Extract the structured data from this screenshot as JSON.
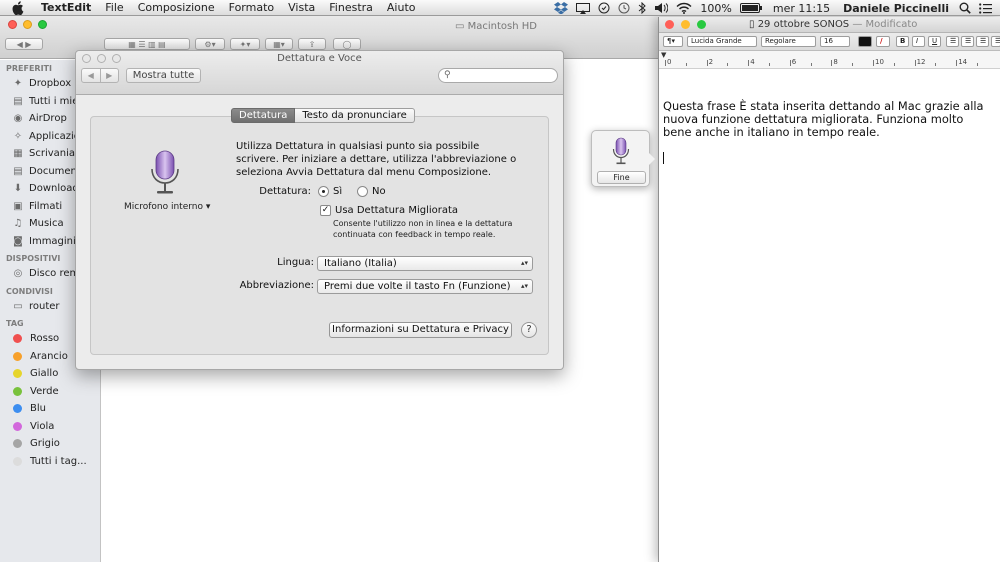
{
  "menubar": {
    "app": "TextEdit",
    "items": [
      "File",
      "Composizione",
      "Formato",
      "Vista",
      "Finestra",
      "Aiuto"
    ],
    "battery": "100%",
    "clock": "mer 11:15",
    "user": "Daniele Piccinelli"
  },
  "finder": {
    "title": "Macintosh HD",
    "sections": {
      "favorites": "PREFERITI",
      "devices": "DISPOSITIVI",
      "shared": "CONDIVISI",
      "tags": "TAG"
    },
    "favorites": [
      "Dropbox",
      "Tutti i miei",
      "AirDrop",
      "Applicazioni",
      "Scrivania",
      "Documenti",
      "Download",
      "Filmati",
      "Musica",
      "Immagini"
    ],
    "devices": [
      "Disco remoto"
    ],
    "shared": [
      "router"
    ],
    "tags": [
      {
        "label": "Rosso",
        "color": "#f0504f"
      },
      {
        "label": "Arancio",
        "color": "#f7a02b"
      },
      {
        "label": "Giallo",
        "color": "#e6d52c"
      },
      {
        "label": "Verde",
        "color": "#79c23c"
      },
      {
        "label": "Blu",
        "color": "#3d8ef0"
      },
      {
        "label": "Viola",
        "color": "#d268dc"
      },
      {
        "label": "Grigio",
        "color": "#a5a5a5"
      },
      {
        "label": "Tutti i tag...",
        "color": "#dcdcdc"
      }
    ]
  },
  "prefs": {
    "title": "Dettatura e Voce",
    "show_all": "Mostra tutte",
    "search_placeholder": "",
    "tabs": [
      "Dettatura",
      "Testo da pronunciare"
    ],
    "mic_label": "Microfono interno ▾",
    "description": "Utilizza Dettatura in qualsiasi punto sia possibile scrivere. Per iniziare a dettare, utilizza l'abbreviazione o seleziona Avvia Dettatura dal menu Composizione.",
    "dictation_label": "Dettatura:",
    "radio_on": "Sì",
    "radio_off": "No",
    "enhanced_label": "Usa Dettatura Migliorata",
    "enhanced_note": "Consente l'utilizzo non in linea e la dettatura continuata con feedback in tempo reale.",
    "language_label": "Lingua:",
    "language_value": "Italiano (Italia)",
    "shortcut_label": "Abbreviazione:",
    "shortcut_value": "Premi due volte il tasto Fn (Funzione)",
    "info_button": "Informazioni su Dettatura e Privacy",
    "help": "?"
  },
  "dictation_popover": {
    "done": "Fine"
  },
  "textedit": {
    "title": "29 ottobre SONOS",
    "modified": "— Modificato",
    "font_family": "Lucida Grande",
    "font_style": "Regolare",
    "font_size": "16",
    "format_buttons": [
      "B",
      "I",
      "U"
    ],
    "ruler_numbers": [
      "0",
      "2",
      "4",
      "6",
      "8",
      "10",
      "12",
      "14"
    ],
    "body": "Questa frase È stata inserita dettando al Mac grazie alla nuova funzione dettatura migliorata. Funziona molto bene anche in italiano in tempo reale."
  }
}
